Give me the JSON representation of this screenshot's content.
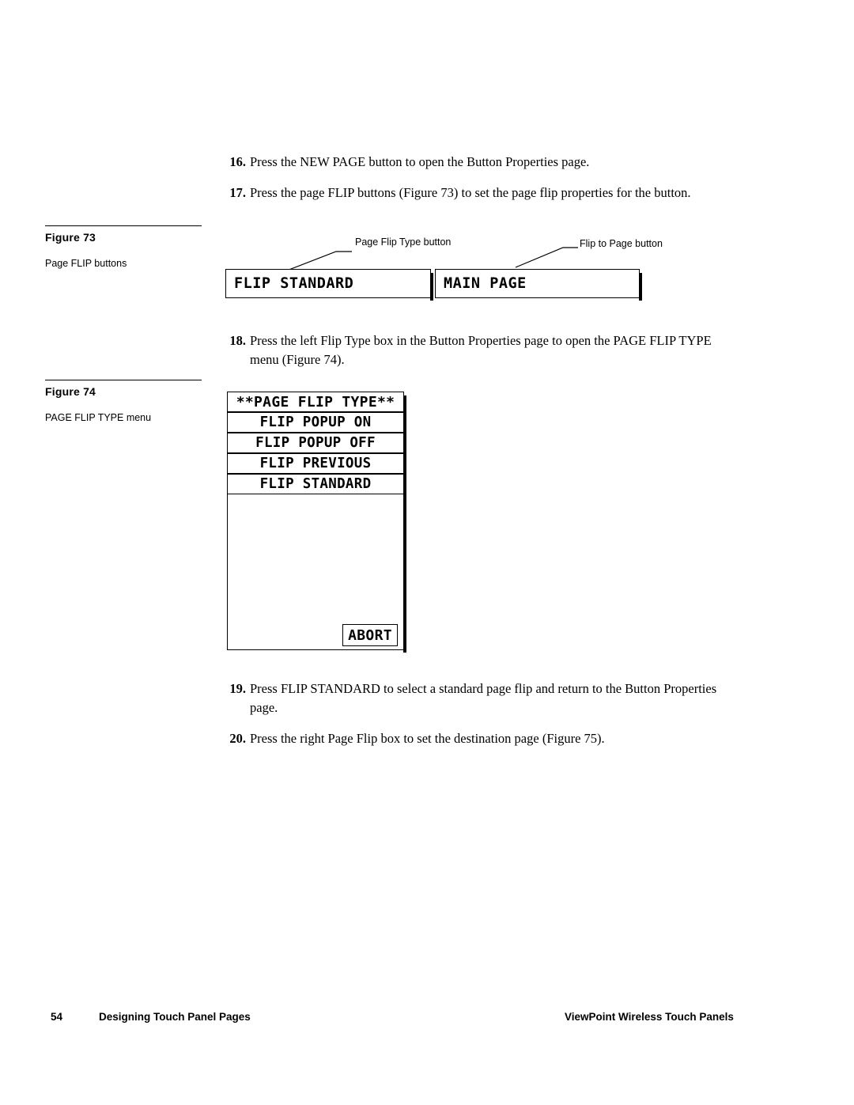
{
  "steps": [
    {
      "num": "16.",
      "text": "Press the NEW PAGE button to open the Button Properties page."
    },
    {
      "num": "17.",
      "text": "Press the page FLIP buttons (Figure 73) to set the page flip properties for the button."
    },
    {
      "num": "18.",
      "text": "Press the left Flip Type box in the Button Properties page to open the PAGE FLIP TYPE menu (Figure 74)."
    },
    {
      "num": "19.",
      "text": "Press FLIP STANDARD to select a standard page flip and return to the Button Properties page."
    },
    {
      "num": "20.",
      "text": "Press the right Page Flip box to set the destination page (Figure 75)."
    }
  ],
  "figures": [
    {
      "title": "Figure 73",
      "caption": "Page FLIP buttons"
    },
    {
      "title": "Figure 74",
      "caption": "PAGE FLIP TYPE menu"
    }
  ],
  "callouts": {
    "page_flip_type": "Page Flip Type button",
    "flip_to_page": "Flip to Page button"
  },
  "flip_buttons": {
    "flip_standard": "FLIP STANDARD",
    "main_page": "MAIN PAGE"
  },
  "flip_type_menu": {
    "header": "**PAGE FLIP TYPE**",
    "items": [
      "FLIP POPUP ON",
      "FLIP POPUP OFF",
      "FLIP PREVIOUS",
      "FLIP STANDARD"
    ],
    "abort": "ABORT"
  },
  "footer": {
    "page_number": "54",
    "left": "Designing Touch Panel Pages",
    "right": "ViewPoint Wireless Touch Panels"
  }
}
